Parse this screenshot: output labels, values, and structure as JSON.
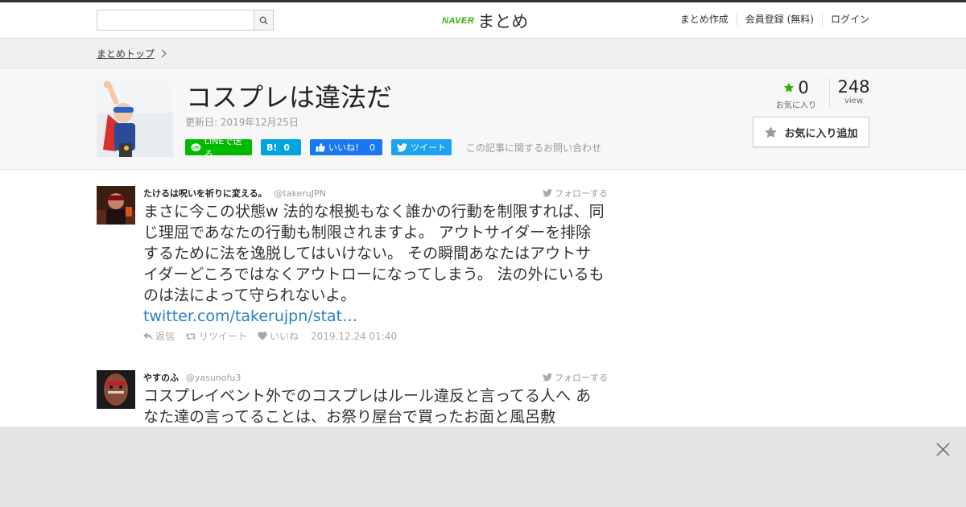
{
  "header": {
    "search": {
      "placeholder": "",
      "value": ""
    },
    "logo_brand": "NAVER",
    "logo_name": "まとめ",
    "nav": [
      "まとめ作成",
      "会員登録 (無料)",
      "ログイン"
    ]
  },
  "breadcrumb": {
    "top": "まとめトップ"
  },
  "article": {
    "title": "コスプレは違法だ",
    "updated": "更新日: 2019年12月25日",
    "share": {
      "line": "LINEで送る",
      "hatena_label": "B!",
      "hatena_count": "0",
      "fb_label": "いいね！",
      "fb_count": "0",
      "tweet": "ツイート"
    },
    "inquiry": "この記事に関するお問い合わせ",
    "favorites": {
      "count": "0",
      "label": "お気に入り"
    },
    "views": {
      "count": "248",
      "label": "view"
    },
    "fav_button": "お気に入り追加"
  },
  "tweets": [
    {
      "user": "たけるは呪いを祈りに変える。",
      "handle": "@takeruJPN",
      "follow": "フォローする",
      "text": "まさに今この状態w 法的な根拠もなく誰かの行動を制限すれば、同じ理屈であなたの行動も制限されますよ。 アウトサイダーを排除するために法を逸脱してはいけない。 その瞬間あなたはアウトサイダーどころではなくアウトローになってしまう。 法の外にいるものは法によって守られないよ。",
      "link": "twitter.com/takerujpn/stat…",
      "reply": "返信",
      "retweet": "リツイート",
      "like": "いいね",
      "time": "2019.12.24 01:40"
    },
    {
      "user": "やすのふ",
      "handle": "@yasunofu3",
      "follow": "フォローする",
      "text": "コスプレイベント外でのコスプレはルール違反と言ってる人へ あなた達の言ってることは、お祭り屋台で買ったお面と風呂敷"
    }
  ],
  "colors": {
    "naver_green": "#2db400",
    "line": "#00b900",
    "hatena": "#00a4de",
    "facebook": "#1877f2",
    "twitter": "#1da1f2",
    "link": "#2a7fc9",
    "star": "#2db400"
  }
}
